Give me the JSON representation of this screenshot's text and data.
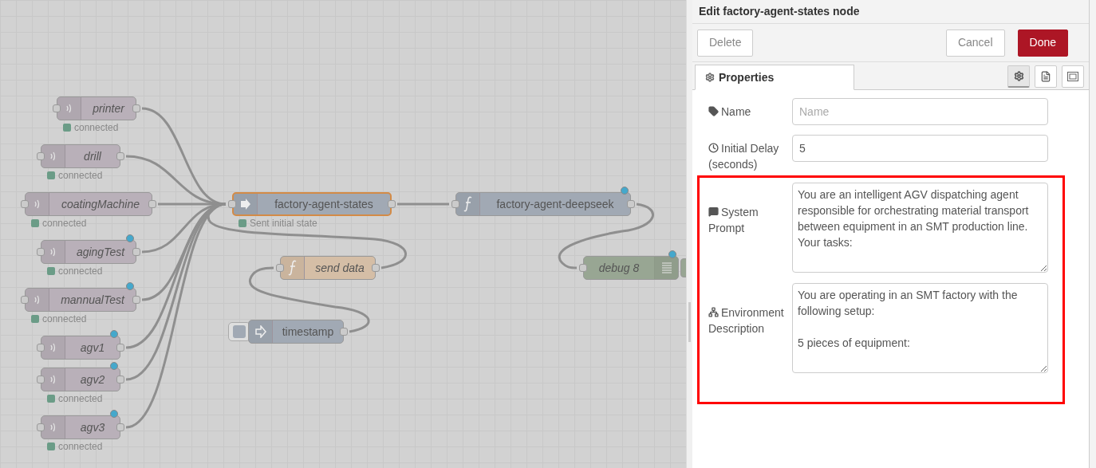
{
  "canvas": {
    "nodes": [
      {
        "kind": "sensor",
        "label": "printer",
        "italic": true,
        "selected": false,
        "changed": false,
        "status": {
          "text": "connected",
          "color": "#6b9c87"
        }
      },
      {
        "kind": "sensor",
        "label": "drill",
        "italic": true,
        "selected": false,
        "changed": false,
        "status": {
          "text": "connected",
          "color": "#6b9c87"
        }
      },
      {
        "kind": "sensor",
        "label": "coatingMachine",
        "italic": true,
        "selected": false,
        "changed": false,
        "status": {
          "text": "connected",
          "color": "#6b9c87"
        }
      },
      {
        "kind": "sensor",
        "label": "agingTest",
        "italic": true,
        "selected": false,
        "changed": true,
        "status": {
          "text": "connected",
          "color": "#6b9c87"
        }
      },
      {
        "kind": "sensor",
        "label": "mannualTest",
        "italic": true,
        "selected": false,
        "changed": true,
        "status": {
          "text": "connected",
          "color": "#6b9c87"
        }
      },
      {
        "kind": "sensor",
        "label": "agv1",
        "italic": true,
        "selected": false,
        "changed": true
      },
      {
        "kind": "sensor",
        "label": "agv2",
        "italic": true,
        "selected": false,
        "changed": true,
        "status": {
          "text": "connected",
          "color": "#6b9c87"
        }
      },
      {
        "kind": "sensor",
        "label": "agv3",
        "italic": true,
        "selected": false,
        "changed": true,
        "status": {
          "text": "connected",
          "color": "#6b9c87"
        }
      },
      {
        "kind": "state",
        "label": "factory-agent-states",
        "italic": false,
        "selected": true,
        "changed": false,
        "status": {
          "text": "Sent initial state",
          "color": "#6b9c87"
        }
      },
      {
        "kind": "function",
        "label": "send data",
        "italic": true,
        "selected": false,
        "changed": false
      },
      {
        "kind": "inject",
        "label": "timestamp",
        "italic": false,
        "selected": false,
        "changed": false
      },
      {
        "kind": "function_ai",
        "label": "factory-agent-deepseek",
        "italic": false,
        "selected": false,
        "changed": true
      },
      {
        "kind": "debug",
        "label": "debug 8",
        "italic": true,
        "selected": false,
        "changed": true
      }
    ]
  },
  "editor": {
    "title": "Edit factory-agent-states node",
    "buttons": [
      {
        "label": "Delete",
        "kind": "plain"
      },
      {
        "label": "Cancel",
        "kind": "plain"
      },
      {
        "label": "Done",
        "kind": "primary"
      }
    ],
    "tabs": [
      {
        "label": "Properties",
        "selected": true
      }
    ],
    "tab_icons": [
      {
        "kind": "gear",
        "selected": true
      },
      {
        "kind": "doc",
        "selected": false
      },
      {
        "kind": "frame",
        "selected": false
      }
    ],
    "fields": [
      {
        "kind": "input",
        "label": "Name",
        "placeholder": "Name"
      },
      {
        "kind": "input",
        "label": "Initial Delay (seconds)",
        "value": "5"
      }
    ],
    "highlighted_fields": [
      {
        "kind": "textarea",
        "label": "System Prompt",
        "value": "You are an intelligent AGV dispatching agent responsible for orchestrating material transport between equipment in an SMT production line. Your tasks:"
      },
      {
        "kind": "textarea",
        "label": "Environment Description",
        "value": "You are operating in an SMT factory with the following setup:\n\n5 pieces of equipment:"
      }
    ]
  }
}
